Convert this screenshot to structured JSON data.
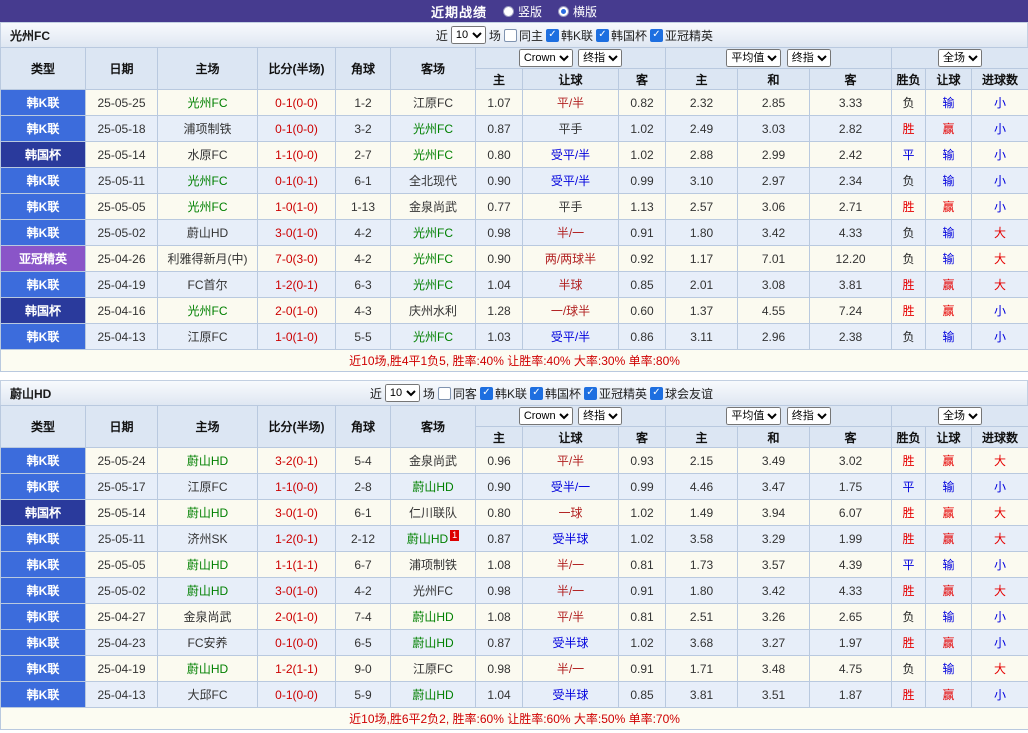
{
  "topbar": {
    "title": "近期战绩",
    "radios": [
      {
        "label": "竖版",
        "selected": false
      },
      {
        "label": "横版",
        "selected": true
      }
    ]
  },
  "colors": {
    "topbar_bg": "#463b8f",
    "header_bg": "#dce6f3",
    "grid_border": "#b9c9df",
    "row_odd": "#fbfaf0",
    "row_even": "#e7eef9",
    "league_kleague": "#3c6cdc",
    "league_cup": "#2a3a9c",
    "league_acl": "#8a55c8",
    "featured_team": "#008000",
    "score_red": "#cc0000",
    "win_red": "#e60000",
    "lose_blue": "#0000dd",
    "neutral_dark": "#222222",
    "handicap_give": "#b22222",
    "handicap_level": "#333333",
    "summary_red": "#cf0000",
    "summary_bg": "#fcfcf2",
    "checkbox_blue": "#1e6fe0"
  },
  "table_header": {
    "type": "类型",
    "date": "日期",
    "home": "主场",
    "score": "比分(半场)",
    "corner": "角球",
    "away": "客场",
    "odds_company": "Crown",
    "odds_stage": "终指",
    "avg_source": "平均值",
    "avg_stage": "终指",
    "scope": "全场",
    "sub": [
      "主",
      "让球",
      "客",
      "主",
      "和",
      "客",
      "胜负",
      "让球",
      "进球数"
    ]
  },
  "sections": [
    {
      "team": "光州FC",
      "filter": {
        "near_label": "近",
        "count": "10",
        "unit_label": "场",
        "venue_label": "同主",
        "venue_checked": false,
        "leagues": [
          "韩K联",
          "韩国杯",
          "亚冠精英"
        ]
      },
      "rows": [
        {
          "league": "韩K联",
          "date": "25-05-25",
          "home": "光州FC",
          "home_featured": true,
          "score": "0-1(0-0)",
          "corner": "1-2",
          "away": "江原FC",
          "away_featured": false,
          "odds_home": "1.07",
          "handicap": "平/半",
          "odds_away": "0.82",
          "avg_home": "2.32",
          "avg_draw": "2.85",
          "avg_away": "3.33",
          "result": "负",
          "handicap_result": "输",
          "goals": "小"
        },
        {
          "league": "韩K联",
          "date": "25-05-18",
          "home": "浦项制铁",
          "home_featured": false,
          "score": "0-1(0-0)",
          "corner": "3-2",
          "away": "光州FC",
          "away_featured": true,
          "odds_home": "0.87",
          "handicap": "平手",
          "odds_away": "1.02",
          "avg_home": "2.49",
          "avg_draw": "3.03",
          "avg_away": "2.82",
          "result": "胜",
          "handicap_result": "赢",
          "goals": "小"
        },
        {
          "league": "韩国杯",
          "date": "25-05-14",
          "home": "水原FC",
          "home_featured": false,
          "score": "1-1(0-0)",
          "corner": "2-7",
          "away": "光州FC",
          "away_featured": true,
          "odds_home": "0.80",
          "handicap": "受平/半",
          "odds_away": "1.02",
          "avg_home": "2.88",
          "avg_draw": "2.99",
          "avg_away": "2.42",
          "result": "平",
          "handicap_result": "输",
          "goals": "小"
        },
        {
          "league": "韩K联",
          "date": "25-05-11",
          "home": "光州FC",
          "home_featured": true,
          "score": "0-1(0-1)",
          "corner": "6-1",
          "away": "全北现代",
          "away_featured": false,
          "odds_home": "0.90",
          "handicap": "受平/半",
          "odds_away": "0.99",
          "avg_home": "3.10",
          "avg_draw": "2.97",
          "avg_away": "2.34",
          "result": "负",
          "handicap_result": "输",
          "goals": "小"
        },
        {
          "league": "韩K联",
          "date": "25-05-05",
          "home": "光州FC",
          "home_featured": true,
          "score": "1-0(1-0)",
          "corner": "1-13",
          "away": "金泉尚武",
          "away_featured": false,
          "odds_home": "0.77",
          "handicap": "平手",
          "odds_away": "1.13",
          "avg_home": "2.57",
          "avg_draw": "3.06",
          "avg_away": "2.71",
          "result": "胜",
          "handicap_result": "赢",
          "goals": "小"
        },
        {
          "league": "韩K联",
          "date": "25-05-02",
          "home": "蔚山HD",
          "home_featured": false,
          "score": "3-0(1-0)",
          "corner": "4-2",
          "away": "光州FC",
          "away_featured": true,
          "odds_home": "0.98",
          "handicap": "半/一",
          "odds_away": "0.91",
          "avg_home": "1.80",
          "avg_draw": "3.42",
          "avg_away": "4.33",
          "result": "负",
          "handicap_result": "输",
          "goals": "大"
        },
        {
          "league": "亚冠精英",
          "date": "25-04-26",
          "home": "利雅得新月(中)",
          "home_featured": false,
          "score": "7-0(3-0)",
          "corner": "4-2",
          "away": "光州FC",
          "away_featured": true,
          "odds_home": "0.90",
          "handicap": "两/两球半",
          "odds_away": "0.92",
          "avg_home": "1.17",
          "avg_draw": "7.01",
          "avg_away": "12.20",
          "result": "负",
          "handicap_result": "输",
          "goals": "大"
        },
        {
          "league": "韩K联",
          "date": "25-04-19",
          "home": "FC首尔",
          "home_featured": false,
          "score": "1-2(0-1)",
          "corner": "6-3",
          "away": "光州FC",
          "away_featured": true,
          "odds_home": "1.04",
          "handicap": "半球",
          "odds_away": "0.85",
          "avg_home": "2.01",
          "avg_draw": "3.08",
          "avg_away": "3.81",
          "result": "胜",
          "handicap_result": "赢",
          "goals": "大"
        },
        {
          "league": "韩国杯",
          "date": "25-04-16",
          "home": "光州FC",
          "home_featured": true,
          "score": "2-0(1-0)",
          "corner": "4-3",
          "away": "庆州水利",
          "away_featured": false,
          "odds_home": "1.28",
          "handicap": "一/球半",
          "odds_away": "0.60",
          "avg_home": "1.37",
          "avg_draw": "4.55",
          "avg_away": "7.24",
          "result": "胜",
          "handicap_result": "赢",
          "goals": "小"
        },
        {
          "league": "韩K联",
          "date": "25-04-13",
          "home": "江原FC",
          "home_featured": false,
          "score": "1-0(1-0)",
          "corner": "5-5",
          "away": "光州FC",
          "away_featured": true,
          "odds_home": "1.03",
          "handicap": "受平/半",
          "odds_away": "0.86",
          "avg_home": "3.11",
          "avg_draw": "2.96",
          "avg_away": "2.38",
          "result": "负",
          "handicap_result": "输",
          "goals": "小"
        }
      ],
      "summary": "近10场,胜4平1负5, 胜率:40% 让胜率:40% 大率:30% 单率:80%"
    },
    {
      "team": "蔚山HD",
      "filter": {
        "near_label": "近",
        "count": "10",
        "unit_label": "场",
        "venue_label": "同客",
        "venue_checked": false,
        "leagues": [
          "韩K联",
          "韩国杯",
          "亚冠精英",
          "球会友谊"
        ]
      },
      "rows": [
        {
          "league": "韩K联",
          "date": "25-05-24",
          "home": "蔚山HD",
          "home_featured": true,
          "score": "3-2(0-1)",
          "corner": "5-4",
          "away": "金泉尚武",
          "away_featured": false,
          "odds_home": "0.96",
          "handicap": "平/半",
          "odds_away": "0.93",
          "avg_home": "2.15",
          "avg_draw": "3.49",
          "avg_away": "3.02",
          "result": "胜",
          "handicap_result": "赢",
          "goals": "大"
        },
        {
          "league": "韩K联",
          "date": "25-05-17",
          "home": "江原FC",
          "home_featured": false,
          "score": "1-1(0-0)",
          "corner": "2-8",
          "away": "蔚山HD",
          "away_featured": true,
          "odds_home": "0.90",
          "handicap": "受半/一",
          "odds_away": "0.99",
          "avg_home": "4.46",
          "avg_draw": "3.47",
          "avg_away": "1.75",
          "result": "平",
          "handicap_result": "输",
          "goals": "小"
        },
        {
          "league": "韩国杯",
          "date": "25-05-14",
          "home": "蔚山HD",
          "home_featured": true,
          "score": "3-0(1-0)",
          "corner": "6-1",
          "away": "仁川联队",
          "away_featured": false,
          "odds_home": "0.80",
          "handicap": "一球",
          "odds_away": "1.02",
          "avg_home": "1.49",
          "avg_draw": "3.94",
          "avg_away": "6.07",
          "result": "胜",
          "handicap_result": "赢",
          "goals": "大"
        },
        {
          "league": "韩K联",
          "date": "25-05-11",
          "home": "济州SK",
          "home_featured": false,
          "score": "1-2(0-1)",
          "corner": "2-12",
          "away": "蔚山HD",
          "away_featured": true,
          "away_badge": "1",
          "odds_home": "0.87",
          "handicap": "受半球",
          "odds_away": "1.02",
          "avg_home": "3.58",
          "avg_draw": "3.29",
          "avg_away": "1.99",
          "result": "胜",
          "handicap_result": "赢",
          "goals": "大"
        },
        {
          "league": "韩K联",
          "date": "25-05-05",
          "home": "蔚山HD",
          "home_featured": true,
          "score": "1-1(1-1)",
          "corner": "6-7",
          "away": "浦项制铁",
          "away_featured": false,
          "odds_home": "1.08",
          "handicap": "半/一",
          "odds_away": "0.81",
          "avg_home": "1.73",
          "avg_draw": "3.57",
          "avg_away": "4.39",
          "result": "平",
          "handicap_result": "输",
          "goals": "小"
        },
        {
          "league": "韩K联",
          "date": "25-05-02",
          "home": "蔚山HD",
          "home_featured": true,
          "score": "3-0(1-0)",
          "corner": "4-2",
          "away": "光州FC",
          "away_featured": false,
          "odds_home": "0.98",
          "handicap": "半/一",
          "odds_away": "0.91",
          "avg_home": "1.80",
          "avg_draw": "3.42",
          "avg_away": "4.33",
          "result": "胜",
          "handicap_result": "赢",
          "goals": "大"
        },
        {
          "league": "韩K联",
          "date": "25-04-27",
          "home": "金泉尚武",
          "home_featured": false,
          "score": "2-0(1-0)",
          "corner": "7-4",
          "away": "蔚山HD",
          "away_featured": true,
          "odds_home": "1.08",
          "handicap": "平/半",
          "odds_away": "0.81",
          "avg_home": "2.51",
          "avg_draw": "3.26",
          "avg_away": "2.65",
          "result": "负",
          "handicap_result": "输",
          "goals": "小"
        },
        {
          "league": "韩K联",
          "date": "25-04-23",
          "home": "FC安养",
          "home_featured": false,
          "score": "0-1(0-0)",
          "corner": "6-5",
          "away": "蔚山HD",
          "away_featured": true,
          "odds_home": "0.87",
          "handicap": "受半球",
          "odds_away": "1.02",
          "avg_home": "3.68",
          "avg_draw": "3.27",
          "avg_away": "1.97",
          "result": "胜",
          "handicap_result": "赢",
          "goals": "小"
        },
        {
          "league": "韩K联",
          "date": "25-04-19",
          "home": "蔚山HD",
          "home_featured": true,
          "score": "1-2(1-1)",
          "corner": "9-0",
          "away": "江原FC",
          "away_featured": false,
          "odds_home": "0.98",
          "handicap": "半/一",
          "odds_away": "0.91",
          "avg_home": "1.71",
          "avg_draw": "3.48",
          "avg_away": "4.75",
          "result": "负",
          "handicap_result": "输",
          "goals": "大"
        },
        {
          "league": "韩K联",
          "date": "25-04-13",
          "home": "大邱FC",
          "home_featured": false,
          "score": "0-1(0-0)",
          "corner": "5-9",
          "away": "蔚山HD",
          "away_featured": true,
          "odds_home": "1.04",
          "handicap": "受半球",
          "odds_away": "0.85",
          "avg_home": "3.81",
          "avg_draw": "3.51",
          "avg_away": "1.87",
          "result": "胜",
          "handicap_result": "赢",
          "goals": "小"
        }
      ],
      "summary": "近10场,胜6平2负2, 胜率:60% 让胜率:60% 大率:50% 单率:70%"
    }
  ]
}
